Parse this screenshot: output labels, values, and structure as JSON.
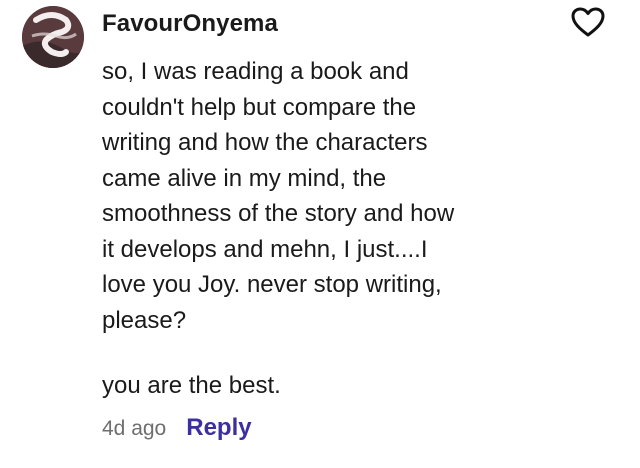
{
  "comment": {
    "username": "FavourOnyema",
    "body_lines": [
      "so, I was reading a book and",
      "couldn't help but compare the",
      "writing and how the characters",
      "came alive in my mind, the",
      "smoothness of the story and how",
      "it develops and mehn, I just....I",
      "love you Joy. never stop writing,",
      "please?"
    ],
    "signoff": "you are the best.",
    "timestamp": "4d ago",
    "reply_label": "Reply",
    "like_icon": "heart-outline-icon"
  },
  "colors": {
    "reply": "#3c2fa0",
    "timestamp": "#6e6e6e",
    "text": "#1a1a1a"
  }
}
